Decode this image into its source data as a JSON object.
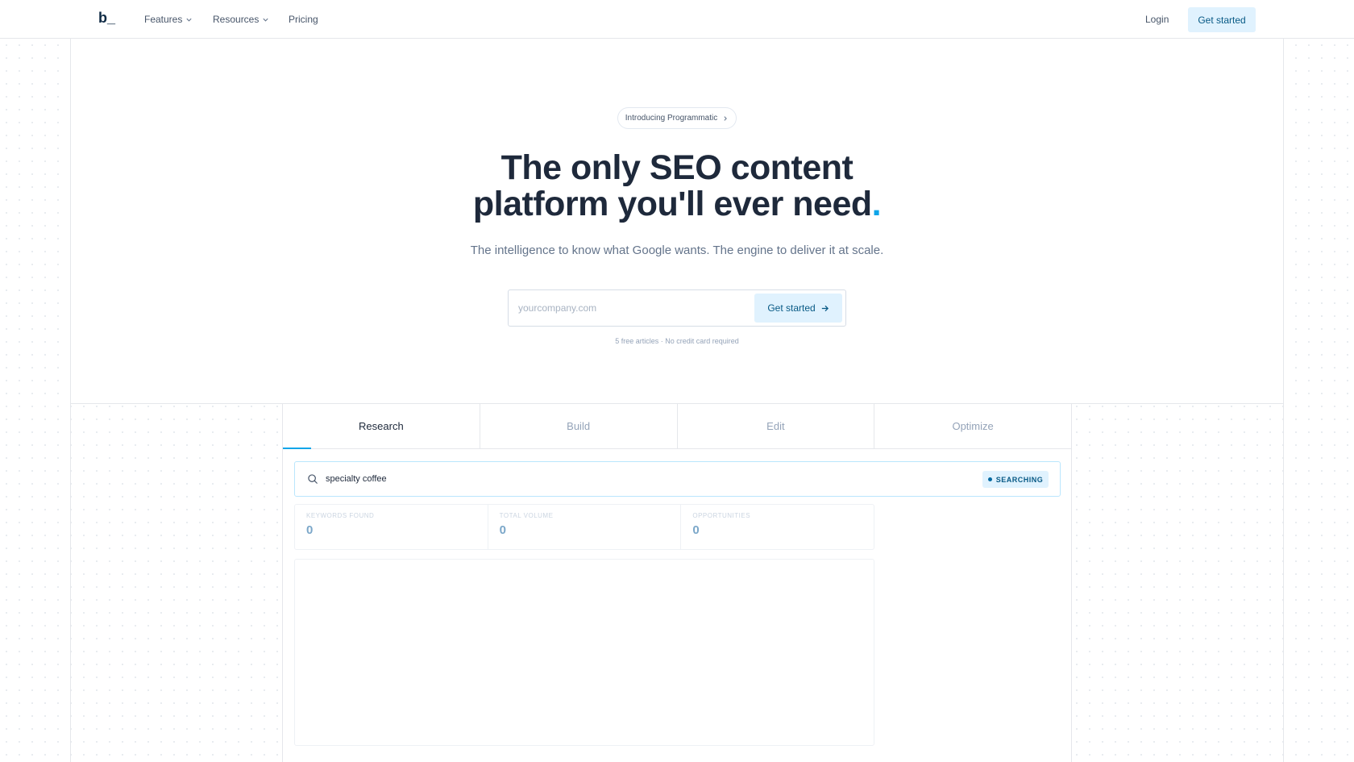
{
  "nav": {
    "logo": "b_",
    "items": [
      {
        "label": "Features",
        "has_dropdown": true
      },
      {
        "label": "Resources",
        "has_dropdown": true
      },
      {
        "label": "Pricing",
        "has_dropdown": false
      }
    ],
    "login": "Login",
    "cta": "Get started"
  },
  "hero": {
    "pill": "Introducing Programmatic",
    "headline_line1": "The only SEO content",
    "headline_line2": "platform you'll ever need",
    "headline_dot": ".",
    "subhead": "The intelligence to know what Google wants. The engine to deliver it at scale.",
    "input_placeholder": "yourcompany.com",
    "input_value": "",
    "button": "Get started",
    "note": "5 free articles · No credit card required"
  },
  "demo": {
    "tabs": [
      {
        "label": "Research",
        "active": true
      },
      {
        "label": "Build",
        "active": false
      },
      {
        "label": "Edit",
        "active": false
      },
      {
        "label": "Optimize",
        "active": false
      }
    ],
    "search_query": "specialty coffee",
    "status_badge": "SEARCHING",
    "stats": [
      {
        "label": "KEYWORDS FOUND",
        "value": "0"
      },
      {
        "label": "TOTAL VOLUME",
        "value": "0"
      },
      {
        "label": "OPPORTUNITIES",
        "value": "0"
      }
    ]
  },
  "colors": {
    "accent": "#0ea5e9",
    "cta_bg": "#e0f2fe",
    "cta_text": "#075985",
    "heading": "#1e293b"
  }
}
